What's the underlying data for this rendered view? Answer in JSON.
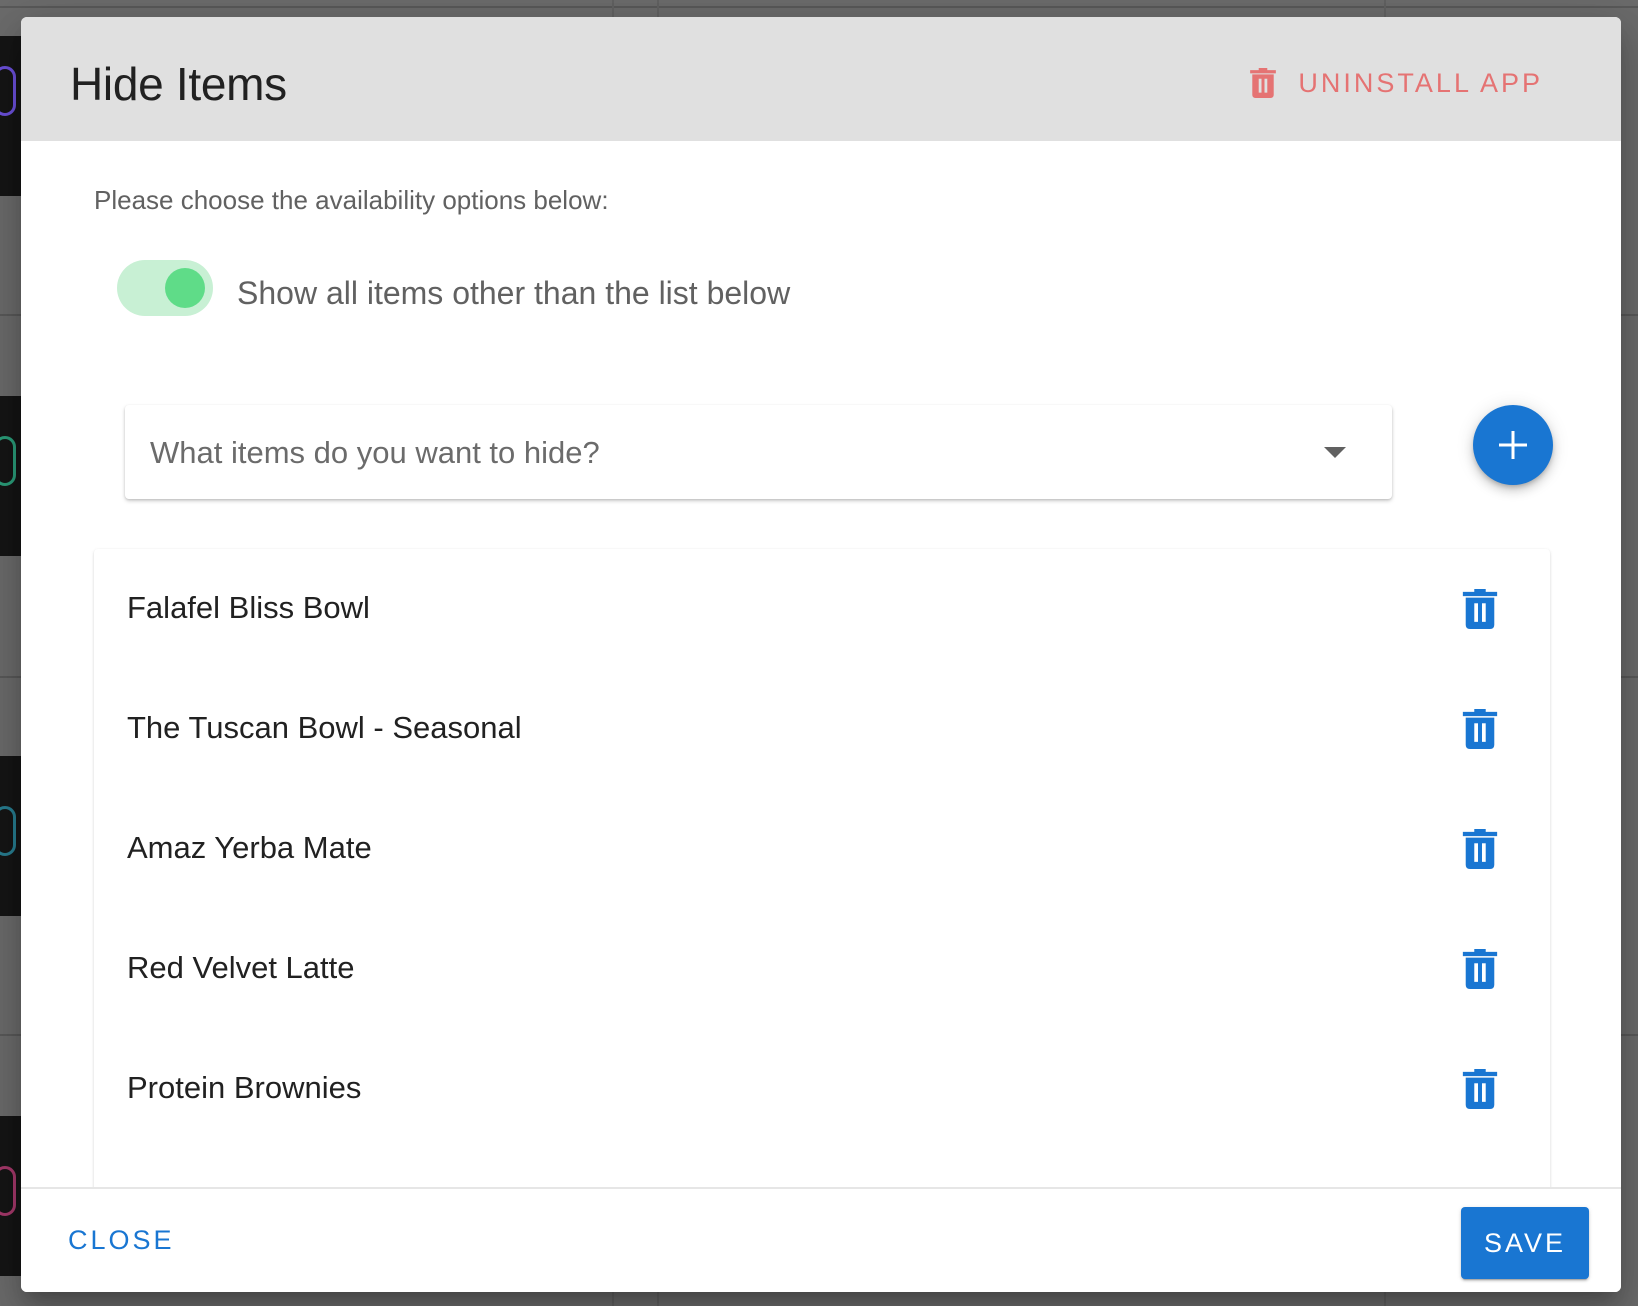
{
  "dialog": {
    "title": "Hide Items",
    "uninstall_label": "UNINSTALL APP",
    "subtitle": "Please choose the availability options below:",
    "toggle": {
      "label": "Show all items other than the list below",
      "checked": true
    },
    "select": {
      "placeholder": "What items do you want to hide?"
    },
    "items": [
      {
        "name": "Falafel Bliss Bowl"
      },
      {
        "name": "The Tuscan Bowl - Seasonal"
      },
      {
        "name": "Amaz Yerba Mate"
      },
      {
        "name": "Red Velvet Latte"
      },
      {
        "name": "Protein Brownies"
      }
    ],
    "footer": {
      "close_label": "CLOSE",
      "save_label": "SAVE"
    }
  },
  "colors": {
    "primary": "#1976d2",
    "danger": "#e57373",
    "toggle_track": "#c8f0d4",
    "toggle_thumb": "#5fdc88",
    "header_bg": "#e0e0e0"
  },
  "icons": {
    "uninstall": "trash-icon",
    "add": "plus-icon",
    "item_delete": "trash-icon",
    "select_caret": "caret-down-icon"
  }
}
